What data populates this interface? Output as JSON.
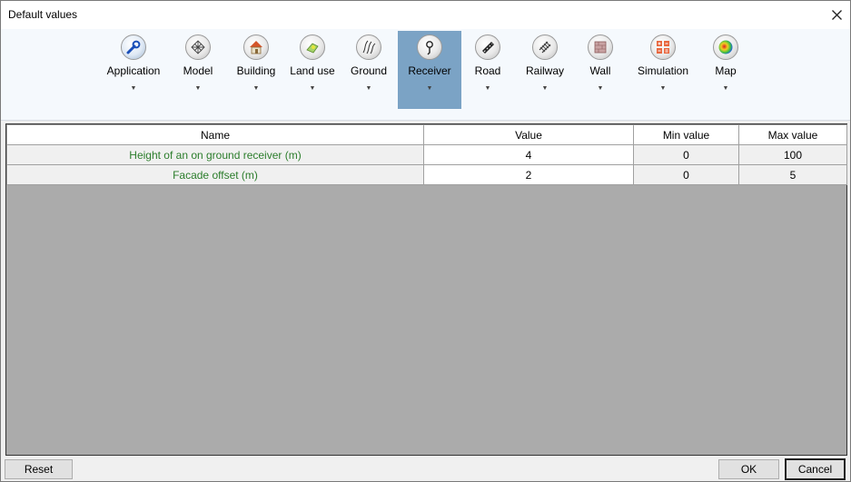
{
  "window": {
    "title": "Default values"
  },
  "ribbon": {
    "items": [
      {
        "label": "Application",
        "icon": "wrench-icon"
      },
      {
        "label": "Model",
        "icon": "mesh-icon"
      },
      {
        "label": "Building",
        "icon": "house-icon"
      },
      {
        "label": "Land use",
        "icon": "land-use-icon"
      },
      {
        "label": "Ground",
        "icon": "ground-icon"
      },
      {
        "label": "Receiver",
        "icon": "receiver-icon"
      },
      {
        "label": "Road",
        "icon": "road-icon"
      },
      {
        "label": "Railway",
        "icon": "railway-icon"
      },
      {
        "label": "Wall",
        "icon": "wall-icon"
      },
      {
        "label": "Simulation",
        "icon": "calculator-icon"
      },
      {
        "label": "Map",
        "icon": "map-icon"
      }
    ],
    "active_label": "Receiver"
  },
  "table": {
    "headers": [
      "Name",
      "Value",
      "Min value",
      "Max value"
    ],
    "rows": [
      {
        "name": "Height of an on ground receiver (m)",
        "value": "4",
        "min": "0",
        "max": "100"
      },
      {
        "name": "Facade offset (m)",
        "value": "2",
        "min": "0",
        "max": "5"
      }
    ]
  },
  "buttons": {
    "reset": "Reset",
    "ok": "OK",
    "cancel": "Cancel"
  },
  "colors": {
    "active_tab": "#7ba3c5",
    "name_text": "#2b7d2b",
    "grid_background": "#ababab"
  }
}
